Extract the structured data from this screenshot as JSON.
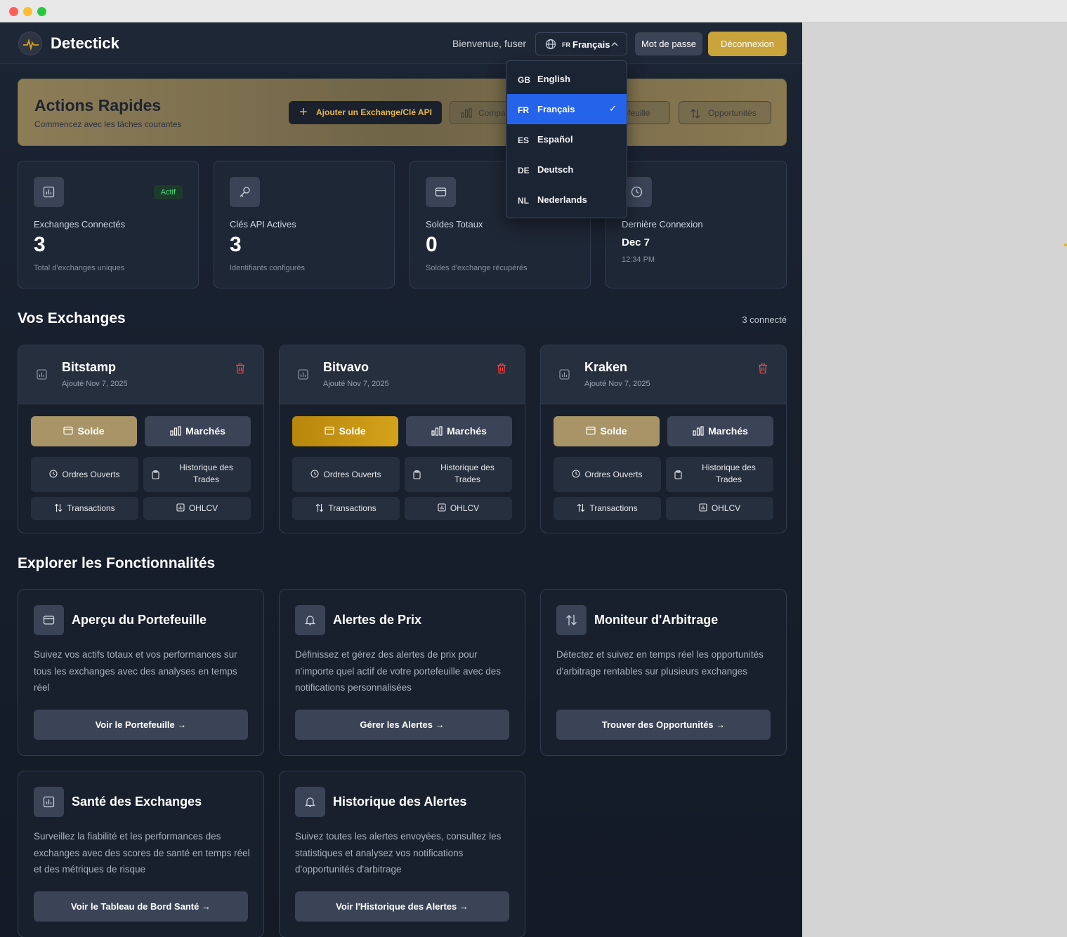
{
  "app": {
    "name": "Detectick"
  },
  "header": {
    "welcome": "Bienvenue, fuser",
    "language": {
      "code": "FR",
      "label": "Français"
    },
    "password_label": "Mot de passe",
    "logout_label": "Déconnexion"
  },
  "language_menu": [
    {
      "code": "GB",
      "label": "English"
    },
    {
      "code": "FR",
      "label": "Français",
      "selected": true
    },
    {
      "code": "ES",
      "label": "Español"
    },
    {
      "code": "DE",
      "label": "Deutsch"
    },
    {
      "code": "NL",
      "label": "Nederlands"
    }
  ],
  "quick_actions": {
    "title": "Actions Rapides",
    "subtitle": "Commencez avec les tâches courantes",
    "add_label": "Ajouter un Exchange/Clé API",
    "compare_label": "Compa",
    "portfolio_label": "tefeuille",
    "opportunities_label": "Opportunités"
  },
  "stats": [
    {
      "label": "Exchanges Connectés",
      "value": "3",
      "sub": "Total d'exchanges uniques",
      "badge": "Actif",
      "icon": "chart-icon"
    },
    {
      "label": "Clés API Actives",
      "value": "3",
      "sub": "Identifiants configurés",
      "icon": "key-icon"
    },
    {
      "label": "Soldes Totaux",
      "value": "0",
      "sub": "Soldes d'exchange récupérés",
      "icon": "wallet-icon"
    },
    {
      "label": "Dernière Connexion",
      "value": "Dec 7",
      "sub": "12:34 PM",
      "icon": "clock-icon"
    }
  ],
  "exchanges_section": {
    "title": "Vos Exchanges",
    "count": "3 connecté"
  },
  "exchanges": [
    {
      "name": "Bitstamp",
      "added": "Ajouté Nov 7, 2025"
    },
    {
      "name": "Bitvavo",
      "added": "Ajouté Nov 7, 2025"
    },
    {
      "name": "Kraken",
      "added": "Ajouté Nov 7, 2025"
    }
  ],
  "exchange_actions": {
    "balance": "Solde",
    "markets": "Marchés",
    "open_orders": "Ordres Ouverts",
    "trade_history": "Historique des Trades",
    "transactions": "Transactions",
    "ohlcv": "OHLCV"
  },
  "features_section": {
    "title": "Explorer les Fonctionnalités"
  },
  "features": [
    {
      "title": "Aperçu du Portefeuille",
      "desc": "Suivez vos actifs totaux et vos performances sur tous les exchanges avec des analyses en temps réel",
      "button": "Voir le Portefeuille →",
      "icon": "wallet-icon"
    },
    {
      "title": "Alertes de Prix",
      "desc": "Définissez et gérez des alertes de prix pour n'importe quel actif de votre portefeuille avec des notifications personnalisées",
      "button": "Gérer les Alertes →",
      "icon": "bell-icon"
    },
    {
      "title": "Moniteur d'Arbitrage",
      "desc": "Détectez et suivez en temps réel les opportunités d'arbitrage rentables sur plusieurs exchanges",
      "button": "Trouver des Opportunités →",
      "icon": "arrows-icon"
    },
    {
      "title": "Santé des Exchanges",
      "desc": "Surveillez la fiabilité et les performances des exchanges avec des scores de santé en temps réel et des métriques de risque",
      "button": "Voir le Tableau de Bord Santé →",
      "icon": "chart-icon"
    },
    {
      "title": "Historique des Alertes",
      "desc": "Suivez toutes les alertes envoyées, consultez les statistiques et analysez vos notifications d'opportunités d'arbitrage",
      "button": "Voir l'Historique des Alertes →",
      "icon": "bell-icon"
    }
  ],
  "colors": {
    "accent": "#c9a33b",
    "selected": "#2563eb",
    "active_badge": "#4ade80",
    "delete": "#ef4444"
  }
}
